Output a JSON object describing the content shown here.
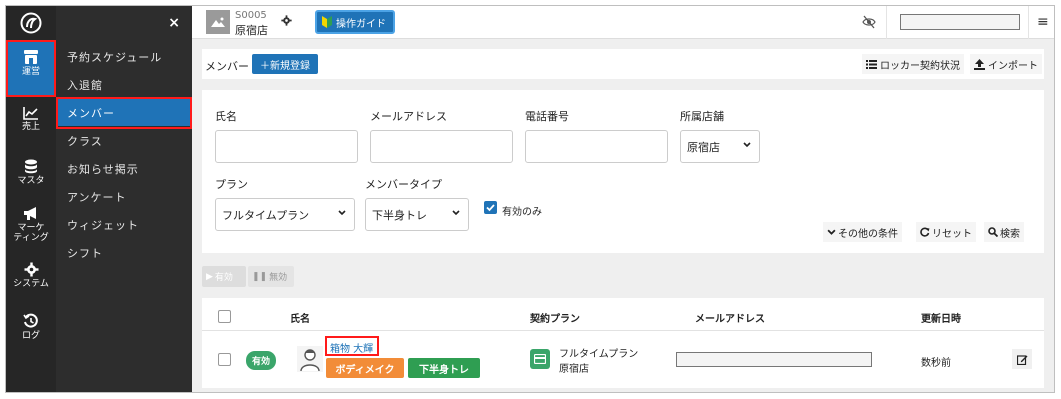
{
  "rail": {
    "items": [
      {
        "label": "運営",
        "icon": "store-icon"
      },
      {
        "label": "売上",
        "icon": "chart-icon"
      },
      {
        "label": "マスタ",
        "icon": "database-icon"
      },
      {
        "label": "マーケ\nティング",
        "icon": "megaphone-icon"
      },
      {
        "label": "システム",
        "icon": "gear-icon"
      },
      {
        "label": "ログ",
        "icon": "history-icon"
      }
    ]
  },
  "submenu": {
    "close": "×",
    "items": [
      "予約スケジュール",
      "入退館",
      "メンバー",
      "クラス",
      "お知らせ掲示",
      "アンケート",
      "ウィジェット",
      "シフト"
    ]
  },
  "topbar": {
    "store_code": "S0005",
    "store_name": "原宿店",
    "thumb_text": "No Image",
    "guide_label": "操作ガイド",
    "menu_glyph": "≡"
  },
  "toolbar": {
    "title": "メンバー",
    "new_label": "＋新規登録",
    "locker_label": "ロッカー契約状況",
    "import_label": "インポート"
  },
  "search": {
    "name_label": "氏名",
    "email_label": "メールアドレス",
    "phone_label": "電話番号",
    "store_label": "所属店舗",
    "store_value": "原宿店",
    "plan_label": "プラン",
    "plan_value": "フルタイムプラン",
    "type_label": "メンバータイプ",
    "type_value": "下半身トレ",
    "active_only_label": "有効のみ",
    "more_label": "その他の条件",
    "reset_label": "リセット",
    "search_label": "検索"
  },
  "actions": {
    "enable_label": "有効",
    "disable_label": "無効"
  },
  "table": {
    "headers": [
      "氏名",
      "契約プラン",
      "メールアドレス",
      "更新日時"
    ],
    "rows": [
      {
        "status": "有効",
        "name": "箱物 大輝",
        "tags": [
          "ボディメイク",
          "下半身トレ"
        ],
        "plan": "フルタイムプラン",
        "store": "原宿店",
        "updated": "数秒前"
      }
    ]
  },
  "colors": {
    "accent": "#1f73b7",
    "highlight": "#ff1a1a",
    "success": "#3aa56a",
    "tag_orange": "#f28c38",
    "tag_green": "#2f9e52"
  }
}
